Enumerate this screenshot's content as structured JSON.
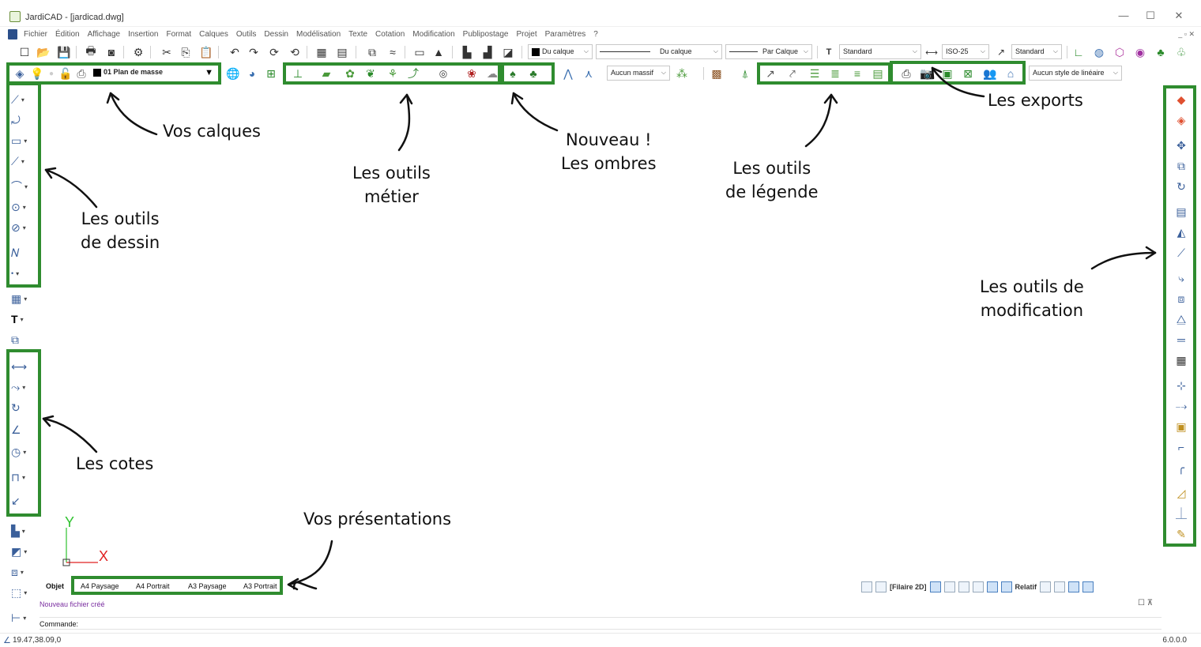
{
  "window": {
    "title": "JardiCAD - [jardicad.dwg]",
    "controls": [
      "—",
      "☐",
      "✕"
    ]
  },
  "menu": {
    "items": [
      "Fichier",
      "Édition",
      "Affichage",
      "Insertion",
      "Format",
      "Calques",
      "Outils",
      "Dessin",
      "Modélisation",
      "Texte",
      "Cotation",
      "Modification",
      "Publipostage",
      "Projet",
      "Paramètres",
      "?"
    ],
    "mdi_controls": "_ ▫ ✕"
  },
  "toolbar1": {
    "color_value": "Du calque",
    "linetype_value": "Du calque",
    "lineweight_value": "Par Calque",
    "text_style": "Standard",
    "dim_style": "ISO-25",
    "multileader_style": "Standard"
  },
  "toolbar2": {
    "layer_name": "01 Plan de masse",
    "massif_value": "Aucun massif",
    "lineaire_value": "Aucun style de linéaire"
  },
  "annotations": {
    "calques": "Vos calques",
    "metier": [
      "Les outils",
      "métier"
    ],
    "ombres": [
      "Nouveau !",
      "Les ombres"
    ],
    "legende": [
      "Les outils",
      "de légende"
    ],
    "exports": "Les exports",
    "dessin": [
      "Les outils",
      "de dessin"
    ],
    "modification": [
      "Les outils de",
      "modification"
    ],
    "cotes": "Les cotes",
    "presentations": "Vos présentations"
  },
  "drawing": {
    "ucs_y": "Y",
    "ucs_x": "X"
  },
  "layout_tabs": {
    "model": "Objet",
    "layouts": [
      "A4 Paysage",
      "A4 Portrait",
      "A3 Paysage",
      "A3 Portrait"
    ]
  },
  "status_tools": {
    "view_mode": "[Filaire 2D]",
    "relative": "Relatif"
  },
  "message": "Nouveau fichier créé",
  "command": {
    "label": "Commande:"
  },
  "statusbar": {
    "coords": "19.47,38.09,0",
    "version": "6.0.0.0"
  },
  "colors": {
    "highlight_green": "#2f8c2f",
    "ucs_y": "#2fc22f",
    "ucs_x": "#e02020",
    "message": "#7a2ea0"
  }
}
